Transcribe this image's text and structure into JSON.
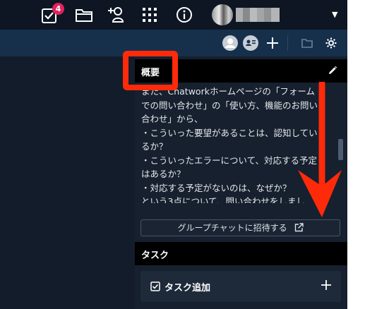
{
  "topbar": {
    "task_badge_count": "4",
    "icons": [
      "task-check-icon",
      "folder-icon",
      "add-contact-icon",
      "apps-grid-icon",
      "info-icon",
      "account-menu-caret-icon"
    ]
  },
  "subbar": {
    "icons": [
      "member-avatar",
      "member-avatar",
      "member-avatar-default",
      "member-contact-card-icon",
      "add-member-plus-icon",
      "file-folder-icon",
      "settings-gear-icon"
    ]
  },
  "overview": {
    "title": "概要",
    "description": "また、Chatworkホームページの「フォーム\nでの問い合わせ」の「使い方、機能のお問い\n合わせ」から、\n・こういった要望があることは、認知してい\nるか？\n・こういったエラーについて、対応する予定\nはあるか？\n・対応する予定がないのは、なぜか？\nという3点について、問い合わせをしまし",
    "invite_button": "グループチャットに招待する"
  },
  "tasks": {
    "title": "タスク",
    "add_task": "タスク追加"
  },
  "colors": {
    "topbar_bg": "#0d1622",
    "subbar_bg": "#16304c",
    "panel_bg": "#16202e",
    "badge": "#e0245e",
    "annotation_red": "#ff2a0a"
  }
}
